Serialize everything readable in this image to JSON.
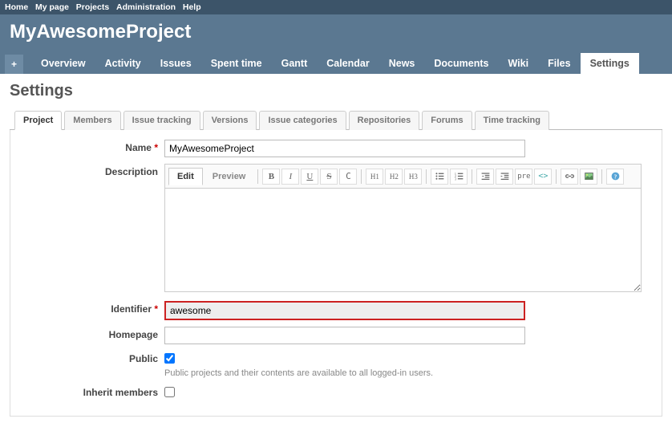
{
  "topmenu": {
    "home": "Home",
    "mypage": "My page",
    "projects": "Projects",
    "admin": "Administration",
    "help": "Help"
  },
  "header": {
    "title": "MyAwesomeProject"
  },
  "mainmenu": {
    "plus": "+",
    "overview": "Overview",
    "activity": "Activity",
    "issues": "Issues",
    "spent_time": "Spent time",
    "gantt": "Gantt",
    "calendar": "Calendar",
    "news": "News",
    "documents": "Documents",
    "wiki": "Wiki",
    "files": "Files",
    "settings": "Settings"
  },
  "page": {
    "title": "Settings"
  },
  "tabs": {
    "project": "Project",
    "members": "Members",
    "issue_tracking": "Issue tracking",
    "versions": "Versions",
    "issue_categories": "Issue categories",
    "repositories": "Repositories",
    "forums": "Forums",
    "time_tracking": "Time tracking"
  },
  "form": {
    "name_label": "Name",
    "name_value": "MyAwesomeProject",
    "description_label": "Description",
    "identifier_label": "Identifier",
    "identifier_value": "awesome",
    "homepage_label": "Homepage",
    "homepage_value": "",
    "public_label": "Public",
    "public_hint": "Public projects and their contents are available to all logged-in users.",
    "inherit_label": "Inherit members",
    "required": "*"
  },
  "editor": {
    "edit": "Edit",
    "preview": "Preview",
    "h1": "H1",
    "h2": "H2",
    "h3": "H3",
    "pre": "pre"
  }
}
